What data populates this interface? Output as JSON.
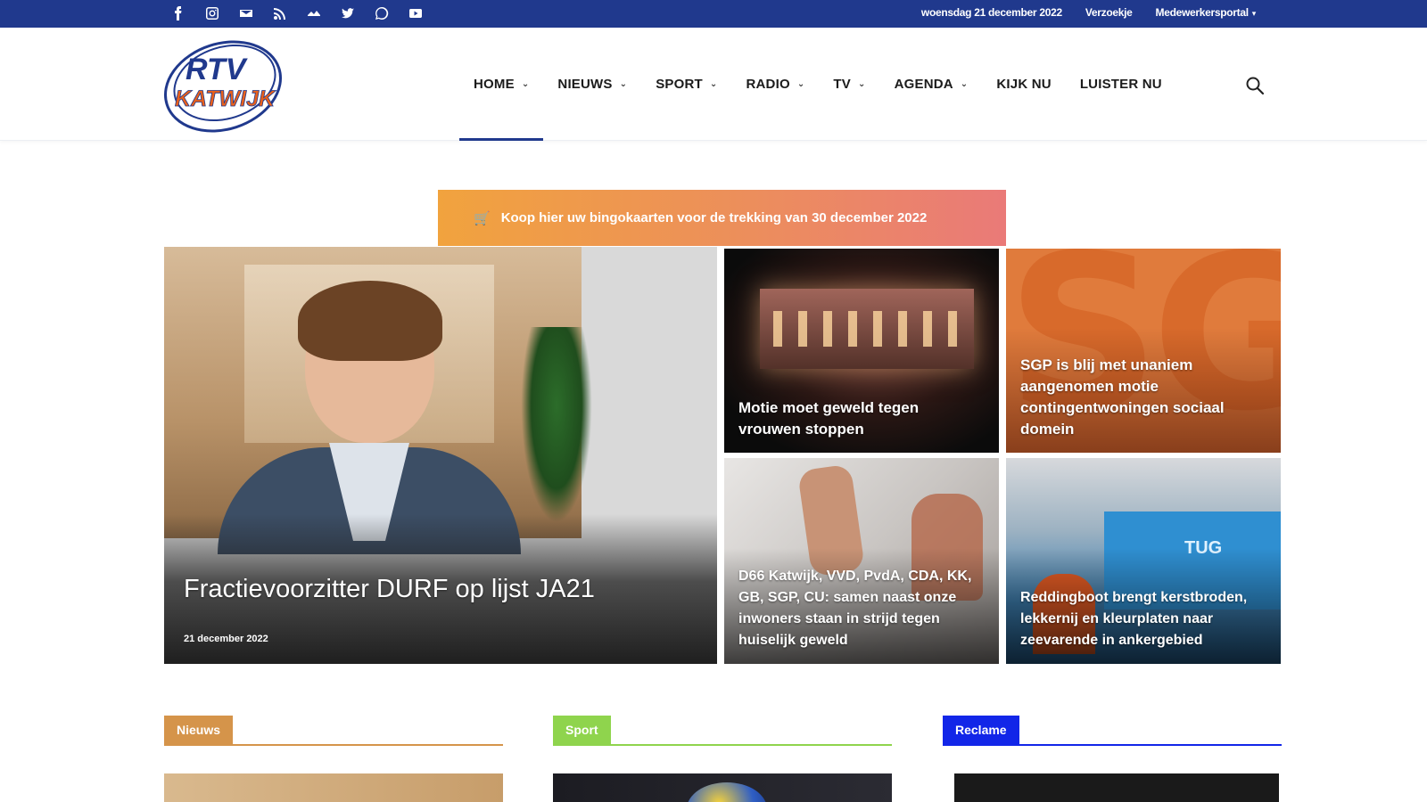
{
  "topbar": {
    "social_icons": [
      "facebook-icon",
      "instagram-icon",
      "mail-icon",
      "rss-icon",
      "soundcloud-icon",
      "twitter-icon",
      "whatsapp-icon",
      "youtube-icon"
    ],
    "date": "woensdag 21 december 2022",
    "link_send": "Verzoekje",
    "link_portal": "Medewerkersportal"
  },
  "header": {
    "logo_line1": "RTV",
    "logo_line2": "KATWIJK",
    "nav": [
      {
        "label": "HOME",
        "has_dropdown": true,
        "active": true
      },
      {
        "label": "NIEUWS",
        "has_dropdown": true,
        "active": false
      },
      {
        "label": "SPORT",
        "has_dropdown": true,
        "active": false
      },
      {
        "label": "RADIO",
        "has_dropdown": true,
        "active": false
      },
      {
        "label": "TV",
        "has_dropdown": true,
        "active": false
      },
      {
        "label": "AGENDA",
        "has_dropdown": true,
        "active": false
      },
      {
        "label": "KIJK NU",
        "has_dropdown": false,
        "active": false
      },
      {
        "label": "LUISTER NU",
        "has_dropdown": false,
        "active": false
      }
    ]
  },
  "promo": {
    "text": "Koop hier uw bingokaarten voor de trekking van 30 december 2022"
  },
  "hero": {
    "main": {
      "title": "Fractievoorzitter DURF op lijst JA21",
      "date": "21 december 2022"
    },
    "tiles": [
      {
        "title": "Motie moet geweld tegen vrouwen stoppen"
      },
      {
        "title": "SGP is blij met unaniem aangenomen motie contingentwoningen sociaal domein",
        "bg_text": "SGI"
      },
      {
        "title": "D66 Katwijk, VVD, PvdA, CDA, KK, GB, SGP, CU: samen naast onze inwoners staan in strijd tegen huiselijk geweld"
      },
      {
        "title": "Reddingboot brengt kerstbroden, lekkernij en kleurplaten naar zeevarende in ankergebied",
        "boat_text": "TUG"
      }
    ]
  },
  "sections": [
    {
      "label": "Nieuws",
      "color": "#d5944a"
    },
    {
      "label": "Sport",
      "color": "#8fd44d"
    },
    {
      "label": "Reclame",
      "color": "#1226e8"
    }
  ],
  "colors": {
    "topbar": "#20398d",
    "accent": "#20398d",
    "logo_orange": "#e8601c"
  }
}
